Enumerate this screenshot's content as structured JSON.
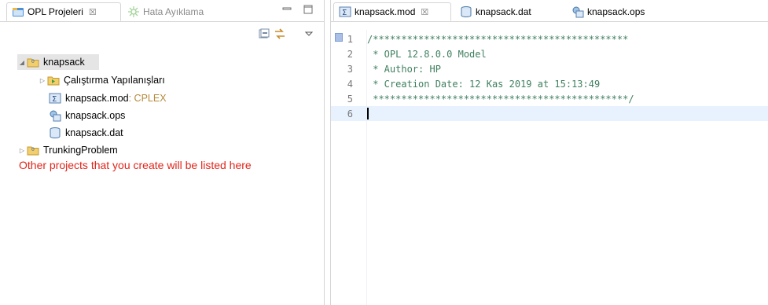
{
  "left_panel": {
    "tabs": [
      {
        "label": "OPL Projeleri",
        "close": "☒"
      },
      {
        "label": "Hata Ayıklama"
      }
    ],
    "tree": {
      "project1": {
        "label": "knapsack"
      },
      "run_configs": {
        "label": "Çalıştırma Yapılanışları"
      },
      "mod_file": {
        "label": "knapsack.mod",
        "suffix": " : CPLEX"
      },
      "ops_file": {
        "label": "knapsack.ops"
      },
      "dat_file": {
        "label": "knapsack.dat"
      },
      "project2": {
        "label": "TrunkingProblem"
      }
    },
    "annotation": "Other projects that you create will be listed here"
  },
  "editor": {
    "tabs": [
      {
        "label": "knapsack.mod",
        "close": "☒"
      },
      {
        "label": "knapsack.dat"
      },
      {
        "label": "knapsack.ops"
      }
    ],
    "lines": [
      {
        "num": "1",
        "text": "/*********************************************"
      },
      {
        "num": "2",
        "text": " * OPL 12.8.0.0 Model"
      },
      {
        "num": "3",
        "text": " * Author: HP"
      },
      {
        "num": "4",
        "text": " * Creation Date: 12 Kas 2019 at 15:13:49"
      },
      {
        "num": "5",
        "text": " *********************************************/"
      },
      {
        "num": "6",
        "text": ""
      }
    ]
  },
  "colors": {
    "comment": "#3f7f5f",
    "annotation": "#e0251b",
    "suffix": "#b58a3a",
    "current_line": "#e8f2fe"
  },
  "icons": {
    "opl_projects_tab": "opl-projects-icon",
    "debug_tab": "debug-icon",
    "minimize": "minimize-icon",
    "maximize": "maximize-icon",
    "collapse_all": "collapse-all-icon",
    "link_editor": "link-with-editor-icon",
    "view_menu": "view-menu-icon"
  }
}
